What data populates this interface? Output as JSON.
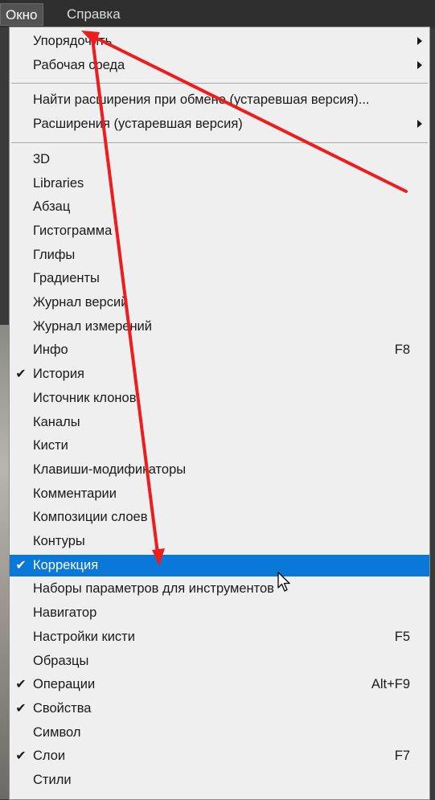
{
  "menubar": {
    "items": [
      "Окно",
      "Справка"
    ],
    "active_index": 0
  },
  "menu": {
    "groups": [
      [
        {
          "label": "Упорядочить",
          "submenu": true
        },
        {
          "label": "Рабочая среда",
          "submenu": true
        }
      ],
      [
        {
          "label": "Найти расширения при обмене (устаревшая версия)...",
          "submenu": false
        },
        {
          "label": "Расширения (устаревшая версия)",
          "submenu": true
        }
      ],
      [
        {
          "label": "3D"
        },
        {
          "label": "Libraries"
        },
        {
          "label": "Абзац"
        },
        {
          "label": "Гистограмма"
        },
        {
          "label": "Глифы"
        },
        {
          "label": "Градиенты"
        },
        {
          "label": "Журнал версий"
        },
        {
          "label": "Журнал измерений"
        },
        {
          "label": "Инфо",
          "shortcut": "F8"
        },
        {
          "label": "История",
          "checked": true
        },
        {
          "label": "Источник клонов"
        },
        {
          "label": "Каналы"
        },
        {
          "label": "Кисти"
        },
        {
          "label": "Клавиши-модификаторы"
        },
        {
          "label": "Комментарии"
        },
        {
          "label": "Композиции слоев"
        },
        {
          "label": "Контуры"
        },
        {
          "label": "Коррекция",
          "checked": true,
          "highlighted": true
        },
        {
          "label": "Наборы параметров для инструментов"
        },
        {
          "label": "Навигатор"
        },
        {
          "label": "Настройки кисти",
          "shortcut": "F5"
        },
        {
          "label": "Образцы"
        },
        {
          "label": "Операции",
          "checked": true,
          "shortcut": "Alt+F9"
        },
        {
          "label": "Свойства",
          "checked": true
        },
        {
          "label": "Символ"
        },
        {
          "label": "Слои",
          "checked": true,
          "shortcut": "F7"
        },
        {
          "label": "Стили"
        }
      ]
    ],
    "check_glyph": "✔"
  },
  "colors": {
    "menubar_bg": "#2f2f2f",
    "menu_bg": "#efefef",
    "highlight": "#0a78d7",
    "annotation_arrow": "#ee1c1c"
  },
  "icons": {
    "check": "checkmark-icon",
    "submenu": "submenu-arrow-icon",
    "pointer": "mouse-cursor-icon"
  }
}
